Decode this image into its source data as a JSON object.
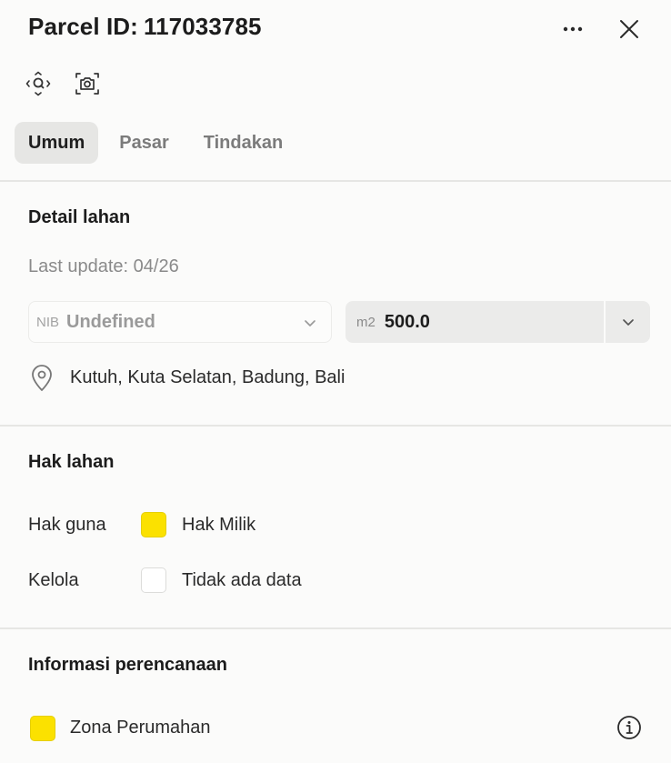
{
  "header": {
    "title_label": "Parcel ID:",
    "parcel_id": "117033785",
    "more_icon": "more-horizontal-icon",
    "close_icon": "close-icon"
  },
  "toolbar": {
    "items": [
      {
        "icon": "zoom-to-parcel-icon"
      },
      {
        "icon": "camera-icon"
      }
    ]
  },
  "tabs": [
    {
      "label": "Umum",
      "active": true
    },
    {
      "label": "Pasar",
      "active": false
    },
    {
      "label": "Tindakan",
      "active": false
    }
  ],
  "land_details": {
    "title": "Detail lahan",
    "last_update": "Last update: 04/26",
    "nib": {
      "prefix": "NIB",
      "value": "Undefined"
    },
    "area": {
      "prefix": "m2",
      "value": "500.0"
    },
    "location": "Kutuh, Kuta Selatan, Badung, Bali"
  },
  "land_rights": {
    "title": "Hak lahan",
    "rows": [
      {
        "label": "Hak guna",
        "value": "Hak Milik",
        "swatch_color": "#fbe100"
      },
      {
        "label": "Kelola",
        "value": "Tidak ada data",
        "swatch_color": "#ffffff"
      }
    ]
  },
  "planning": {
    "title": "Informasi perencanaan",
    "zone": {
      "label": "Zona Perumahan",
      "swatch_color": "#fbe100"
    }
  },
  "colors": {
    "accent_yellow": "#fbe100",
    "active_tab_bg": "#e6e6e4",
    "panel_bg": "#fbfbfa"
  }
}
